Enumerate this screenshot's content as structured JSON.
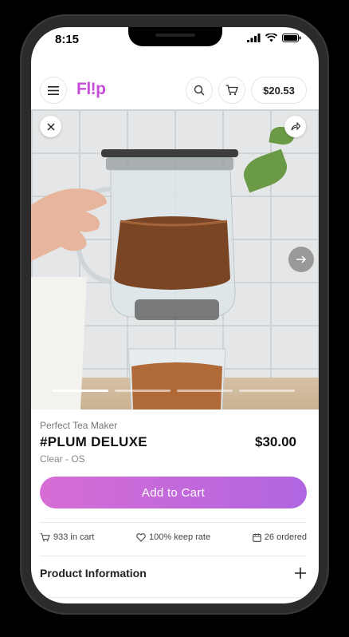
{
  "status": {
    "time": "8:15"
  },
  "header": {
    "logo": "Fl!p",
    "balance": "$20.53"
  },
  "hero": {
    "image_subject": "glass tea maker with brewing tea above a cup",
    "slide_count": 4,
    "active_slide": 1
  },
  "product": {
    "brand": "Perfect Tea Maker",
    "name": "#PLUM DELUXE",
    "variant": "Clear - OS",
    "price": "$30.00",
    "cta": "Add to Cart"
  },
  "stats": {
    "in_cart": "933 in cart",
    "keep_rate": "100% keep rate",
    "ordered": "26 ordered"
  },
  "info": {
    "title": "Product Information"
  },
  "colors": {
    "accent_start": "#d76dd5",
    "accent_end": "#b065e0",
    "logo": "#c44fd6"
  }
}
